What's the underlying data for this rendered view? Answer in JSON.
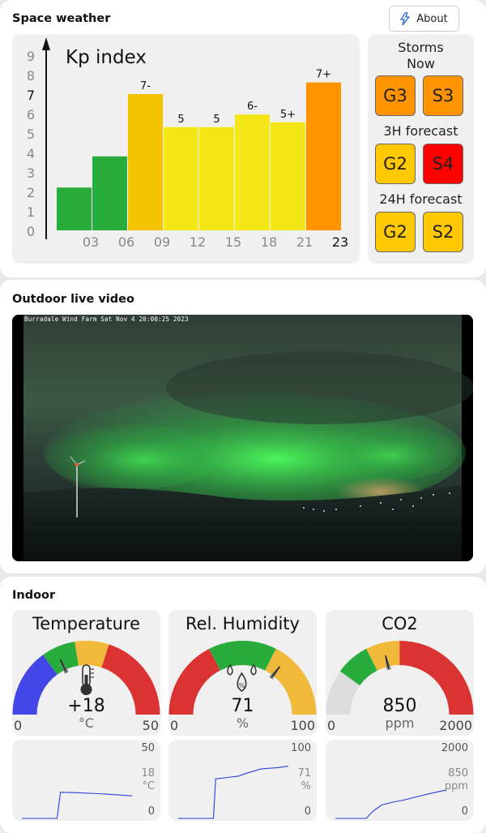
{
  "space_weather": {
    "title": "Space weather",
    "about_label": "About",
    "kp": {
      "title": "Kp index",
      "y_ticks": [
        "0",
        "1",
        "2",
        "3",
        "4",
        "5",
        "6",
        "7",
        "8",
        "9"
      ],
      "x_ticks": [
        "03",
        "06",
        "09",
        "12",
        "15",
        "18",
        "21",
        "23"
      ],
      "bars": [
        {
          "value": 2.2,
          "label": "",
          "color": "#28ac3c"
        },
        {
          "value": 3.8,
          "label": "",
          "color": "#28ac3c"
        },
        {
          "value": 7.0,
          "label": "7-",
          "color": "#f5c400"
        },
        {
          "value": 5.3,
          "label": "5",
          "color": "#f5e617"
        },
        {
          "value": 5.3,
          "label": "5",
          "color": "#f5e617"
        },
        {
          "value": 5.95,
          "label": "6-",
          "color": "#f5e617"
        },
        {
          "value": 5.55,
          "label": "5+",
          "color": "#f5e617"
        },
        {
          "value": 7.6,
          "label": "7+",
          "color": "#ff9400"
        }
      ]
    },
    "storms": {
      "now_label": "Storms Now",
      "now": [
        {
          "text": "G3",
          "color": "#ff9400"
        },
        {
          "text": "S3",
          "color": "#ff9400"
        }
      ],
      "forecast_3h_label": "3H forecast",
      "forecast_3h": [
        {
          "text": "G2",
          "color": "#ffc800"
        },
        {
          "text": "S4",
          "color": "#ff0000"
        }
      ],
      "forecast_24h_label": "24H forecast",
      "forecast_24h": [
        {
          "text": "G2",
          "color": "#ffc800"
        },
        {
          "text": "S2",
          "color": "#ffc800"
        }
      ]
    }
  },
  "outdoor": {
    "title": "Outdoor live video",
    "timestamp": "Burradale Wind Farm Sat Nov  4 20:00:25 2023"
  },
  "indoor": {
    "title": "Indoor",
    "gauges": [
      {
        "title": "Temperature",
        "value": "+18",
        "unit": "°C",
        "min": "0",
        "max": "50",
        "icon": "thermometer-icon",
        "fraction": 0.36,
        "zones": [
          {
            "to": 0.3,
            "color": "#4347e8"
          },
          {
            "to": 0.45,
            "color": "#28ac3c"
          },
          {
            "to": 0.6,
            "color": "#f0b93a"
          },
          {
            "to": 1,
            "color": "#db3232"
          }
        ]
      },
      {
        "title": "Rel. Humidity",
        "value": "71",
        "unit": "%",
        "min": "0",
        "max": "100",
        "icon": "humidity-icon",
        "fraction": 0.71,
        "zones": [
          {
            "to": 0.35,
            "color": "#db3232"
          },
          {
            "to": 0.65,
            "color": "#28ac3c"
          },
          {
            "to": 1,
            "color": "#f0b93a"
          }
        ]
      },
      {
        "title": "CO2",
        "value": "850",
        "unit": "ppm",
        "min": "0",
        "max": "2000",
        "icon": "",
        "fraction": 0.425,
        "zones": [
          {
            "to": 0.2,
            "color": "#dcdcdc"
          },
          {
            "to": 0.35,
            "color": "#28ac3c"
          },
          {
            "to": 0.5,
            "color": "#f0b93a"
          },
          {
            "to": 1,
            "color": "#db3232"
          }
        ]
      }
    ],
    "trends": [
      {
        "max": "50",
        "current": "18",
        "unit": "°C",
        "min": "0",
        "max_value": 50,
        "points": [
          [
            0,
            0
          ],
          [
            0.32,
            0
          ],
          [
            0.35,
            18.5
          ],
          [
            0.5,
            18.2
          ],
          [
            0.7,
            17.5
          ],
          [
            1,
            16
          ]
        ]
      },
      {
        "max": "100",
        "current": "71",
        "unit": "%",
        "min": "0",
        "max_value": 100,
        "points": [
          [
            0,
            0
          ],
          [
            0.32,
            0
          ],
          [
            0.34,
            56
          ],
          [
            0.45,
            58
          ],
          [
            0.55,
            60
          ],
          [
            0.62,
            64
          ],
          [
            0.75,
            70
          ],
          [
            0.9,
            72
          ],
          [
            1,
            74
          ]
        ]
      },
      {
        "max": "2000",
        "current": "850",
        "unit": "ppm",
        "min": "0",
        "max_value": 2000,
        "points": [
          [
            0,
            0
          ],
          [
            0.28,
            0
          ],
          [
            0.34,
            200
          ],
          [
            0.42,
            380
          ],
          [
            0.52,
            460
          ],
          [
            0.62,
            520
          ],
          [
            0.75,
            620
          ],
          [
            0.88,
            720
          ],
          [
            1,
            800
          ]
        ]
      }
    ]
  }
}
